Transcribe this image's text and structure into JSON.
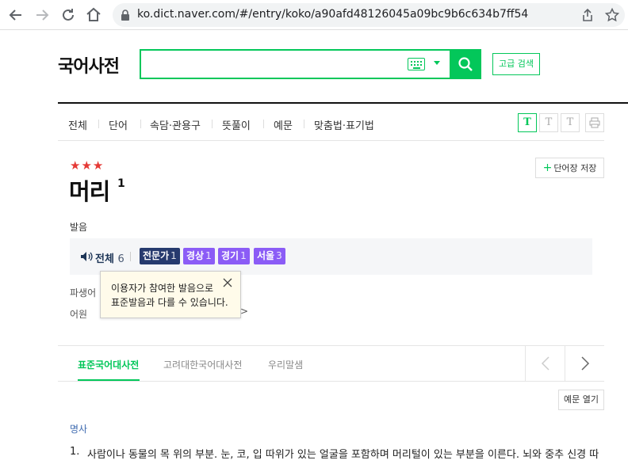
{
  "browser": {
    "url_host": "ko.dict.naver.com",
    "url_path": "/#/entry/koko/a90afd48126045a09bc9b6c634b7ff54",
    "icons": [
      "back-arrow-icon",
      "forward-arrow-icon",
      "reload-icon",
      "home-icon",
      "lock-icon",
      "share-icon",
      "star-icon"
    ]
  },
  "header": {
    "site_title": "국어사전",
    "search_value": "",
    "advanced_search": "고급 검색"
  },
  "tabs": [
    "전체",
    "단어",
    "속담·관용구",
    "뜻풀이",
    "예문",
    "맞춤법·표기법"
  ],
  "font_buttons": [
    "T",
    "T",
    "T"
  ],
  "entry": {
    "stars": "★★★",
    "headword": "머리",
    "superscript": "1",
    "save_button": "단어장 저장",
    "pron_label": "발음",
    "pron_all": "전체",
    "pron_all_count": "6",
    "pron_tags": [
      {
        "label": "전문가",
        "count": "1"
      },
      {
        "label": "경상",
        "count": "1"
      },
      {
        "label": "경기",
        "count": "1"
      },
      {
        "label": "서울",
        "count": "3"
      }
    ],
    "row_derivative": "파생어",
    "row_etymology": "어원",
    "etymology_tail": ">",
    "tooltip_line1": "이용자가 참여한 발음으로",
    "tooltip_line2": "표준발음과 다를 수 있습니다."
  },
  "sources": {
    "tabs": [
      "표준국어대사전",
      "고려대한국어대사전",
      "우리말샘"
    ],
    "active": 0
  },
  "example_toggle": "예문 열기",
  "definition": {
    "pos": "명사",
    "num": "1.",
    "text": "사람이나 동물의 목 위의 부분. 눈, 코, 입 따위가 있는 얼굴을 포함하며 머리털이 있는 부분을 이른다. 뇌와 중추 신경 따"
  },
  "colors": {
    "accent": "#03c75a",
    "star": "#e53935",
    "tag_navy": "#263a6e",
    "tag_purple": "#8b5cf6",
    "pos": "#3f6bb0"
  }
}
